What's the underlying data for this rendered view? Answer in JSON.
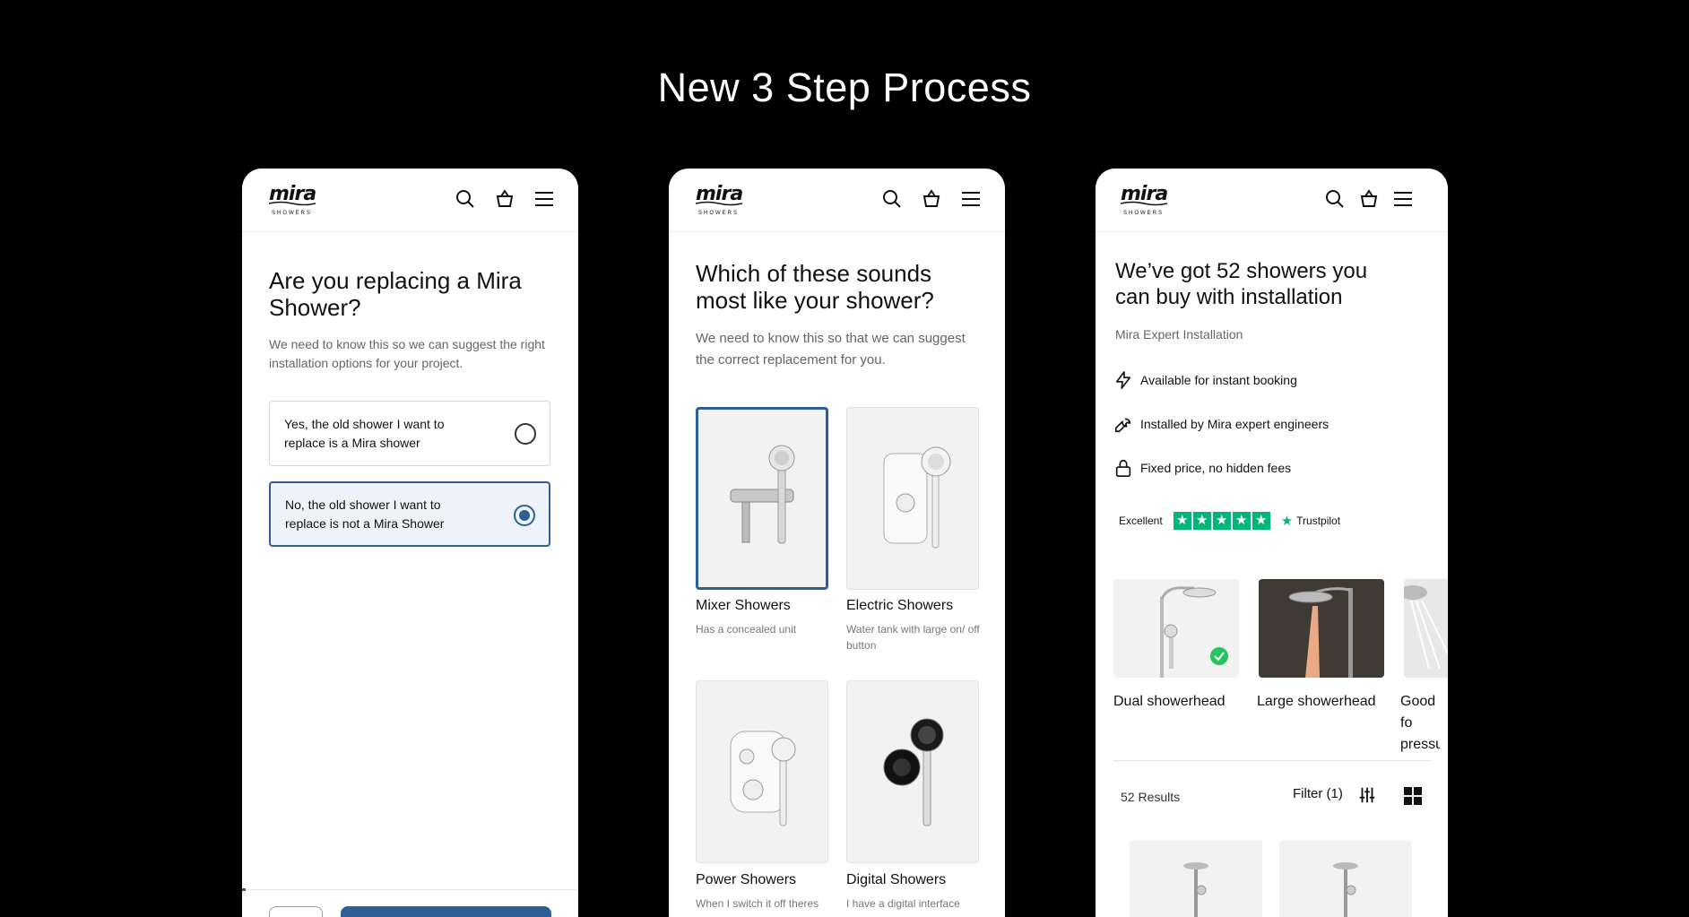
{
  "heading": "New 3 Step Process",
  "brand": {
    "logo_word": "mira",
    "logo_sub": "SHOWERS"
  },
  "icons": {
    "search": "search-icon",
    "basket": "basket-icon",
    "menu": "menu-icon"
  },
  "colors": {
    "accent": "#2f5d96",
    "trustpilot": "#00b67a",
    "check": "#22c55e"
  },
  "screen1": {
    "title": "Are you replacing a Mira Shower?",
    "subtitle": "We need to know this so we can suggest the right installation options for your project.",
    "options": [
      {
        "label": "Yes, the old shower I want to replace is a Mira shower",
        "selected": false
      },
      {
        "label": "No, the old shower I want to replace is not a Mira Shower",
        "selected": true
      }
    ]
  },
  "screen2": {
    "title": "Which of these sounds most like your shower?",
    "subtitle": "We need to know this so that we can suggest the correct replacement for you.",
    "types": [
      {
        "name": "Mixer Showers",
        "desc": "Has a concealed unit",
        "selected": true
      },
      {
        "name": "Electric Showers",
        "desc": "Water tank with large on/ off button",
        "selected": false
      },
      {
        "name": "Power Showers",
        "desc": "When I switch it off theres",
        "selected": false
      },
      {
        "name": "Digital Showers",
        "desc": "I have a digital interface",
        "selected": false
      }
    ]
  },
  "screen3": {
    "title": "We’ve got 52 showers you can buy with installation",
    "section": "Mira Expert Installation",
    "features": [
      {
        "icon": "lightning-icon",
        "text": "Available for instant booking"
      },
      {
        "icon": "wrench-icon",
        "text": "Installed by Mira expert engineers"
      },
      {
        "icon": "lock-icon",
        "text": "Fixed price, no hidden fees"
      }
    ],
    "trustpilot": {
      "rating": "Excellent",
      "brand": "Trustpilot",
      "stars": 5
    },
    "categories": [
      {
        "name": "Dual showerhead",
        "selected": true
      },
      {
        "name": "Large showerhead",
        "selected": false
      },
      {
        "name": "Good fo pressur",
        "selected": false
      }
    ],
    "results": "52 Results",
    "filter": "Filter (1)"
  }
}
